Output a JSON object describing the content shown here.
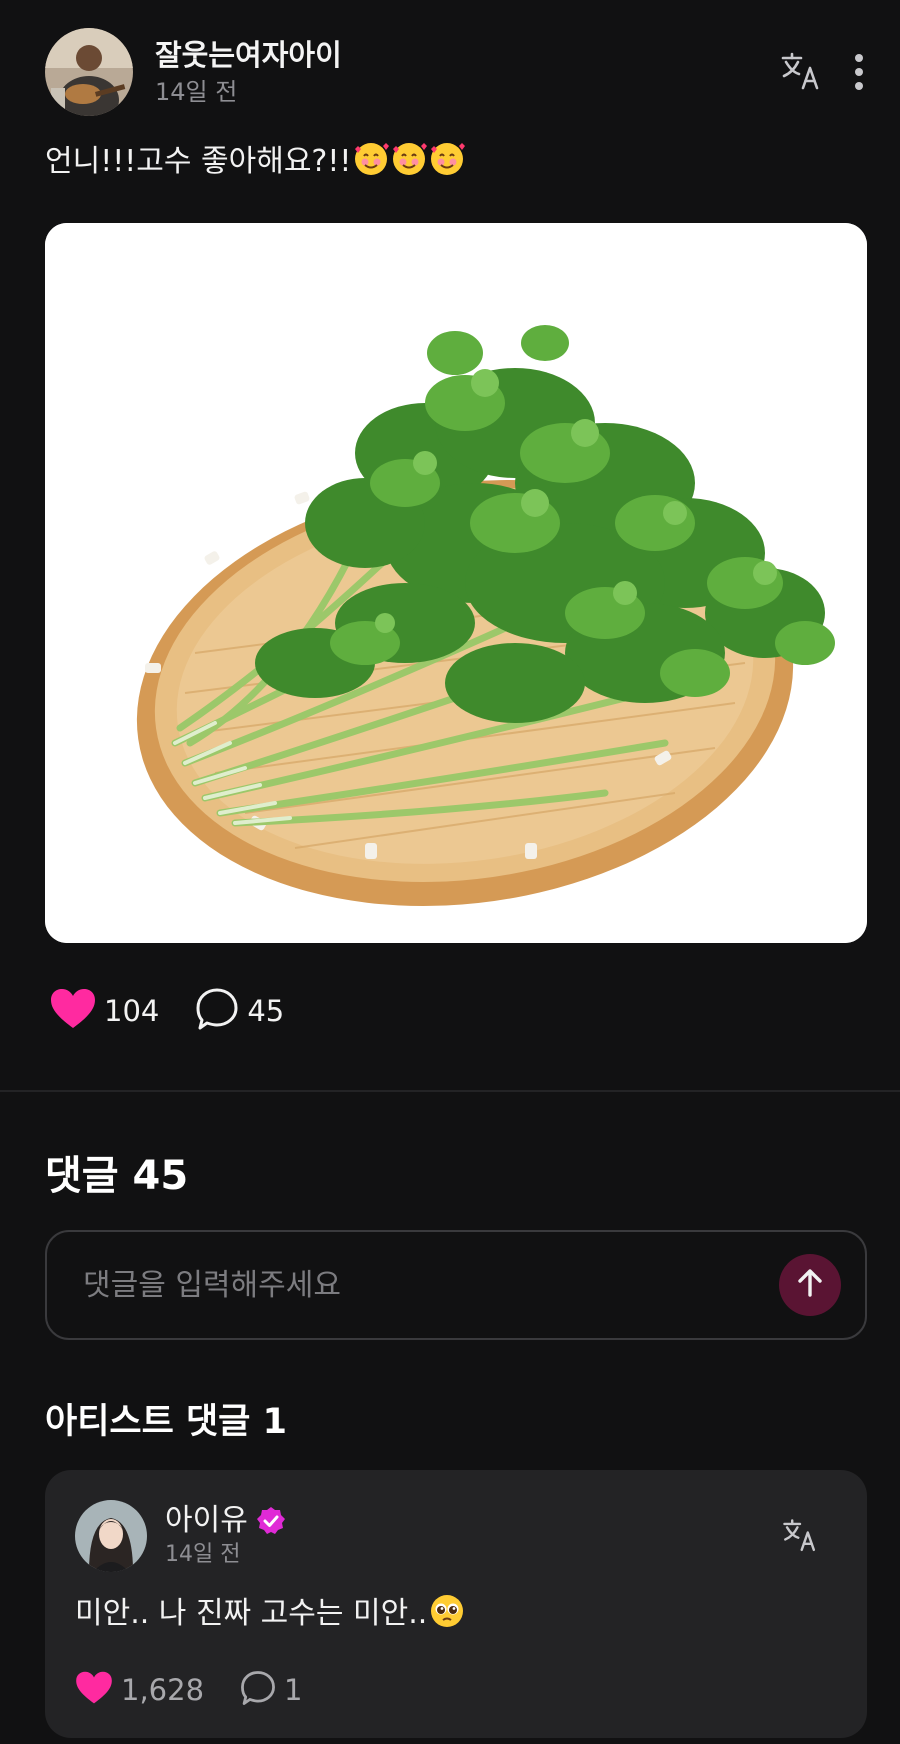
{
  "post": {
    "author": "잘웃는여자아이",
    "time": "14일 전",
    "text": "언니!!!고수 좋아해요?!!",
    "likes": "104",
    "comments": "45"
  },
  "comments_section": {
    "title": "댓글 45",
    "input_placeholder": "댓글을 입력해주세요"
  },
  "artist_section": {
    "title": "아티스트 댓글 1",
    "comment": {
      "author": "아이유",
      "time": "14일 전",
      "text": "미안.. 나 진짜 고수는 미안..",
      "likes": "1,628",
      "replies": "1"
    }
  },
  "icons": {
    "translate": "translate-icon",
    "more": "more-vertical-icon",
    "like": "heart-icon",
    "comment": "speech-bubble-icon",
    "send": "arrow-up-icon",
    "verified": "verified-badge-icon"
  },
  "colors": {
    "background": "#111112",
    "card": "#232325",
    "accent_pink": "#ff2aa0",
    "send_button": "#5a1433",
    "muted_text": "#8e8e93"
  }
}
